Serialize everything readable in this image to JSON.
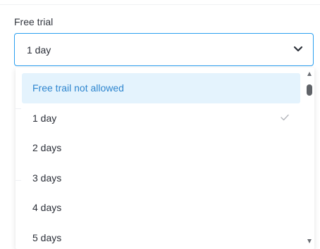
{
  "field": {
    "label": "Free trial",
    "selected_value": "1 day"
  },
  "dropdown": {
    "options": [
      {
        "label": "Free trail not allowed",
        "highlighted": true,
        "selected": false
      },
      {
        "label": "1 day",
        "highlighted": false,
        "selected": true
      },
      {
        "label": "2 days",
        "highlighted": false,
        "selected": false
      },
      {
        "label": "3 days",
        "highlighted": false,
        "selected": false
      },
      {
        "label": "4 days",
        "highlighted": false,
        "selected": false
      },
      {
        "label": "5 days",
        "highlighted": false,
        "selected": false
      }
    ]
  },
  "icons": {
    "chevron": "chevron-down-icon",
    "check": "check-icon"
  },
  "colors": {
    "accent_border": "#2a9ff0",
    "highlight_bg": "#e4f3fd",
    "highlight_text": "#2f86cf"
  }
}
